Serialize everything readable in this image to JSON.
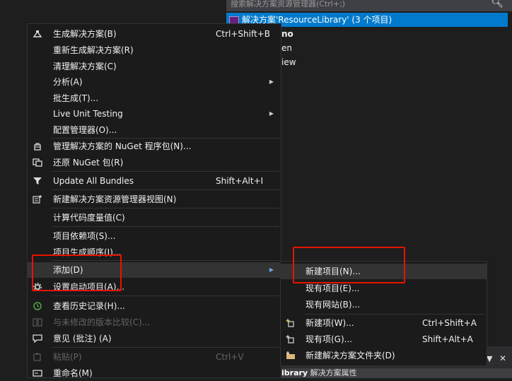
{
  "solution_explorer": {
    "search_placeholder": "搜索解决方案资源管理器(Ctrl+;)",
    "root_label": "解决方案'ResourceLibrary' (3 个项目)",
    "items": [
      "no",
      "en",
      "iew"
    ],
    "bottom_project": "ibrary",
    "bottom_label": "解决方案属性"
  },
  "context_menu": {
    "items": [
      {
        "label": "生成解决方案(B)",
        "shortcut": "Ctrl+Shift+B",
        "icon": "build-icon"
      },
      {
        "label": "重新生成解决方案(R)"
      },
      {
        "label": "清理解决方案(C)"
      },
      {
        "label": "分析(A)",
        "submenu": true
      },
      {
        "label": "批生成(T)..."
      },
      {
        "label": "Live Unit Testing",
        "submenu": true
      },
      {
        "label": "配置管理器(O)..."
      },
      {
        "label": "管理解决方案的 NuGet 程序包(N)...",
        "icon": "nuget-icon"
      },
      {
        "label": "还原 NuGet 包(R)",
        "icon": "restore-icon"
      },
      {
        "label": "Update All Bundles",
        "shortcut": "Shift+Alt+I",
        "icon": "filter-icon"
      },
      {
        "label": "新建解决方案资源管理器视图(N)",
        "icon": "new-view-icon"
      },
      {
        "label": "计算代码度量值(C)"
      },
      {
        "label": "项目依赖项(S)..."
      },
      {
        "label": "项目生成顺序(I)..."
      },
      {
        "label": "添加(D)",
        "submenu": true
      },
      {
        "label": "设置启动项目(A)...",
        "icon": "gear-icon"
      },
      {
        "label": "查看历史记录(H)...",
        "icon": "history-icon"
      },
      {
        "label": "与未修改的版本比较(C)...",
        "disabled": true,
        "icon": "compare-icon"
      },
      {
        "label": "意见 (批注) (A)",
        "icon": "comment-icon"
      },
      {
        "label": "粘贴(P)",
        "shortcut": "Ctrl+V",
        "disabled": true,
        "icon": "paste-icon"
      },
      {
        "label": "重命名(M)",
        "icon": "rename-icon"
      }
    ]
  },
  "add_submenu": {
    "items": [
      {
        "label": "新建项目(N)..."
      },
      {
        "label": "现有项目(E)..."
      },
      {
        "label": "现有网站(B)..."
      },
      {
        "label": "新建项(W)...",
        "shortcut": "Ctrl+Shift+A",
        "icon": "new-item-icon"
      },
      {
        "label": "现有项(G)...",
        "shortcut": "Shift+Alt+A",
        "icon": "existing-item-icon"
      },
      {
        "label": "新建解决方案文件夹(D)",
        "icon": "new-folder-icon"
      }
    ]
  },
  "colors": {
    "accent": "#007acc",
    "menu_bg": "#1b1b1c",
    "highlight_bg": "#333334",
    "annotation": "#e51400"
  }
}
